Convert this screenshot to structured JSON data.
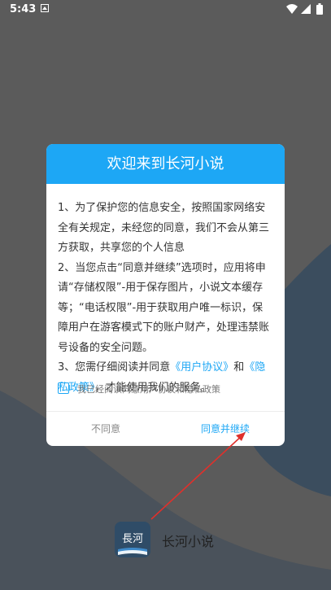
{
  "status_bar": {
    "time": "5:43",
    "icons": [
      "notification-icon",
      "wifi-icon",
      "signal-icon",
      "battery-icon"
    ]
  },
  "dialog": {
    "title": "欢迎来到长河小说",
    "para1": "1、为了保护您的信息安全，按照国家网络安全有关规定，未经您的同意，我们不会从第三方获取，共享您的个人信息",
    "para2": "2、当您点击“同意并继续”选项时，应用将申请“存储权限”-用于保存图片，小说文本缓存等；“电话权限”-用于获取用户唯一标识，保障用户在游客模式下的账户财产，处理违禁账号设备的安全问题。",
    "para3_prefix": "3、您需仔细阅读并同意",
    "user_agreement_link": "《用户协议》",
    "para3_and": "和",
    "privacy_policy_link": "《隐私政策》",
    "para3_suffix": "，才能使用我们的服务。",
    "consent_checkbox_label": "我已经阅读同意用户协议和隐私政策",
    "disagree_label": "不同意",
    "agree_label": "同意并继续"
  },
  "app": {
    "name": "长河小说",
    "logo_text": "長河"
  },
  "colors": {
    "accent": "#1da7f5",
    "overlay_bg": "#5b5b5b",
    "app_logo_bg": "#2f4c67",
    "arrow": "#e0302b"
  }
}
